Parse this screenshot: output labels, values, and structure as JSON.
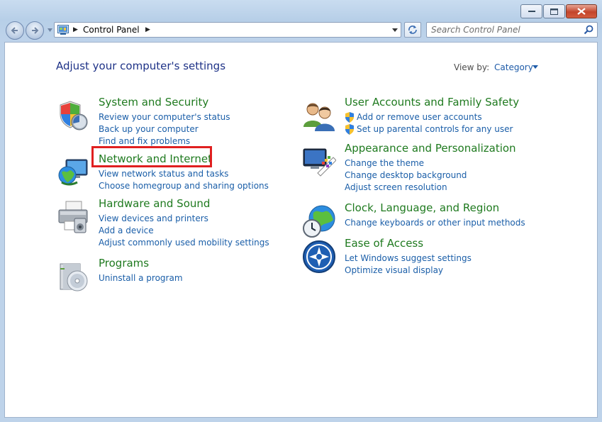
{
  "window": {
    "buttons": {
      "minimize": "–",
      "maximize": "□",
      "close": "✕"
    }
  },
  "navbar": {
    "breadcrumb": "Control Panel",
    "search_placeholder": "Search Control Panel"
  },
  "header": {
    "title": "Adjust your computer's settings",
    "view_by_label": "View by:",
    "view_by_value": "Category"
  },
  "categories": [
    {
      "title": "System and Security",
      "icon": "shield-icon",
      "links": [
        "Review your computer's status",
        "Back up your computer",
        "Find and fix problems"
      ]
    },
    {
      "title": "Network and Internet",
      "icon": "network-globe-icon",
      "links": [
        "View network status and tasks",
        "Choose homegroup and sharing options"
      ]
    },
    {
      "title": "Hardware and Sound",
      "icon": "printer-icon",
      "links": [
        "View devices and printers",
        "Add a device",
        "Adjust commonly used mobility settings"
      ]
    },
    {
      "title": "Programs",
      "icon": "programs-disc-icon",
      "links": [
        "Uninstall a program"
      ]
    },
    {
      "title": "User Accounts and Family Safety",
      "icon": "users-icon",
      "links": [
        "Add or remove user accounts",
        "Set up parental controls for any user"
      ]
    },
    {
      "title": "Appearance and Personalization",
      "icon": "monitor-palette-icon",
      "links": [
        "Change the theme",
        "Change desktop background",
        "Adjust screen resolution"
      ]
    },
    {
      "title": "Clock, Language, and Region",
      "icon": "clock-globe-icon",
      "links": [
        "Change keyboards or other input methods"
      ]
    },
    {
      "title": "Ease of Access",
      "icon": "ease-of-access-icon",
      "links": [
        "Let Windows suggest settings",
        "Optimize visual display"
      ]
    }
  ],
  "colors": {
    "category_title": "#1f7a1f",
    "link": "#1a5ea8",
    "heading": "#1e3287",
    "highlight": "#e02020"
  }
}
